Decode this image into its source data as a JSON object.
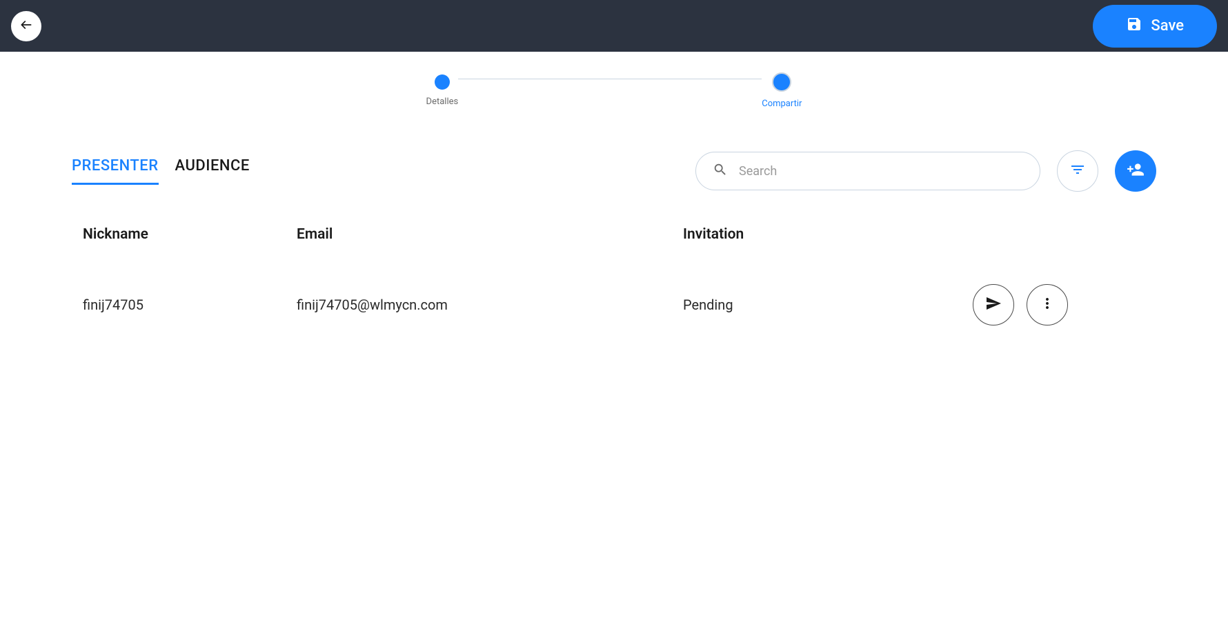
{
  "header": {
    "save_label": "Save"
  },
  "stepper": {
    "steps": [
      {
        "label": "Detalles",
        "active": false
      },
      {
        "label": "Compartir",
        "active": true
      }
    ]
  },
  "tabs": {
    "presenter": "PRESENTER",
    "audience": "AUDIENCE",
    "active": "presenter"
  },
  "search": {
    "placeholder": "Search",
    "value": ""
  },
  "table": {
    "headers": {
      "nickname": "Nickname",
      "email": "Email",
      "invitation": "Invitation"
    },
    "rows": [
      {
        "nickname": "finij74705",
        "email": "finij74705@wlmycn.com",
        "invitation": "Pending"
      }
    ]
  },
  "colors": {
    "primary": "#1a82ff",
    "header_bg": "#2c3340",
    "border": "#c9d4e0"
  }
}
